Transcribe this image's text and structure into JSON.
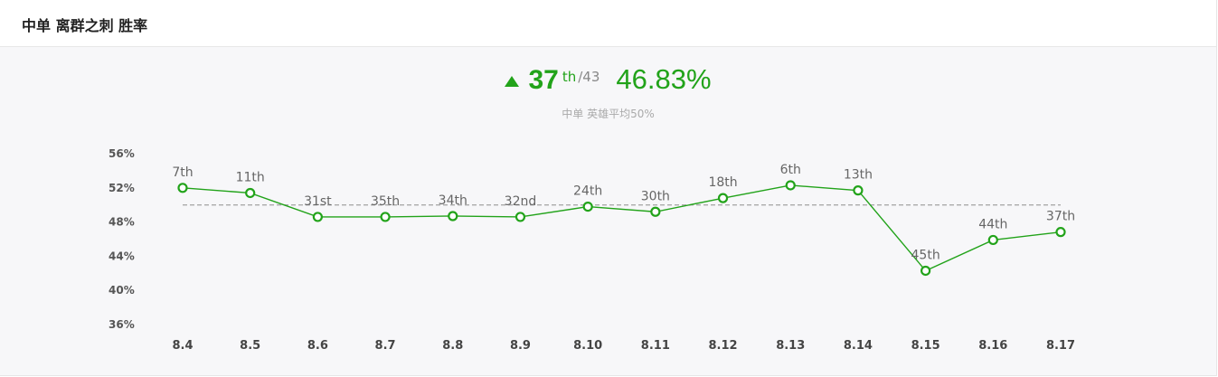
{
  "header": {
    "title": "中单 离群之刺 胜率"
  },
  "summary": {
    "rank": "37",
    "rank_suffix": "th",
    "rank_total": "/43",
    "win_rate": "46.83%",
    "trend": "up",
    "subnote": "中单 英雄平均50%"
  },
  "colors": {
    "accent": "#22a31a",
    "average_line": "#aaaaaa"
  },
  "icons": {
    "trend": "triangle-up-icon"
  },
  "chart_data": {
    "type": "line",
    "title": "",
    "xlabel": "",
    "ylabel": "",
    "categories": [
      "8.4",
      "8.5",
      "8.6",
      "8.7",
      "8.8",
      "8.9",
      "8.10",
      "8.11",
      "8.12",
      "8.13",
      "8.14",
      "8.15",
      "8.16",
      "8.17"
    ],
    "series": [
      {
        "values": [
          52.0,
          51.4,
          48.6,
          48.6,
          48.7,
          48.6,
          49.8,
          49.2,
          50.8,
          52.3,
          51.7,
          42.3,
          45.9,
          46.83
        ],
        "point_labels": [
          "7th",
          "11th",
          "31st",
          "35th",
          "34th",
          "32nd",
          "24th",
          "30th",
          "18th",
          "6th",
          "13th",
          "45th",
          "44th",
          "37th"
        ]
      }
    ],
    "reference_line": 50,
    "ylim": [
      36,
      56
    ],
    "yticks": [
      56,
      52,
      48,
      44,
      40,
      36
    ],
    "ytick_labels": [
      "56%",
      "52%",
      "48%",
      "44%",
      "40%",
      "36%"
    ],
    "grid": false,
    "legend": "none"
  }
}
